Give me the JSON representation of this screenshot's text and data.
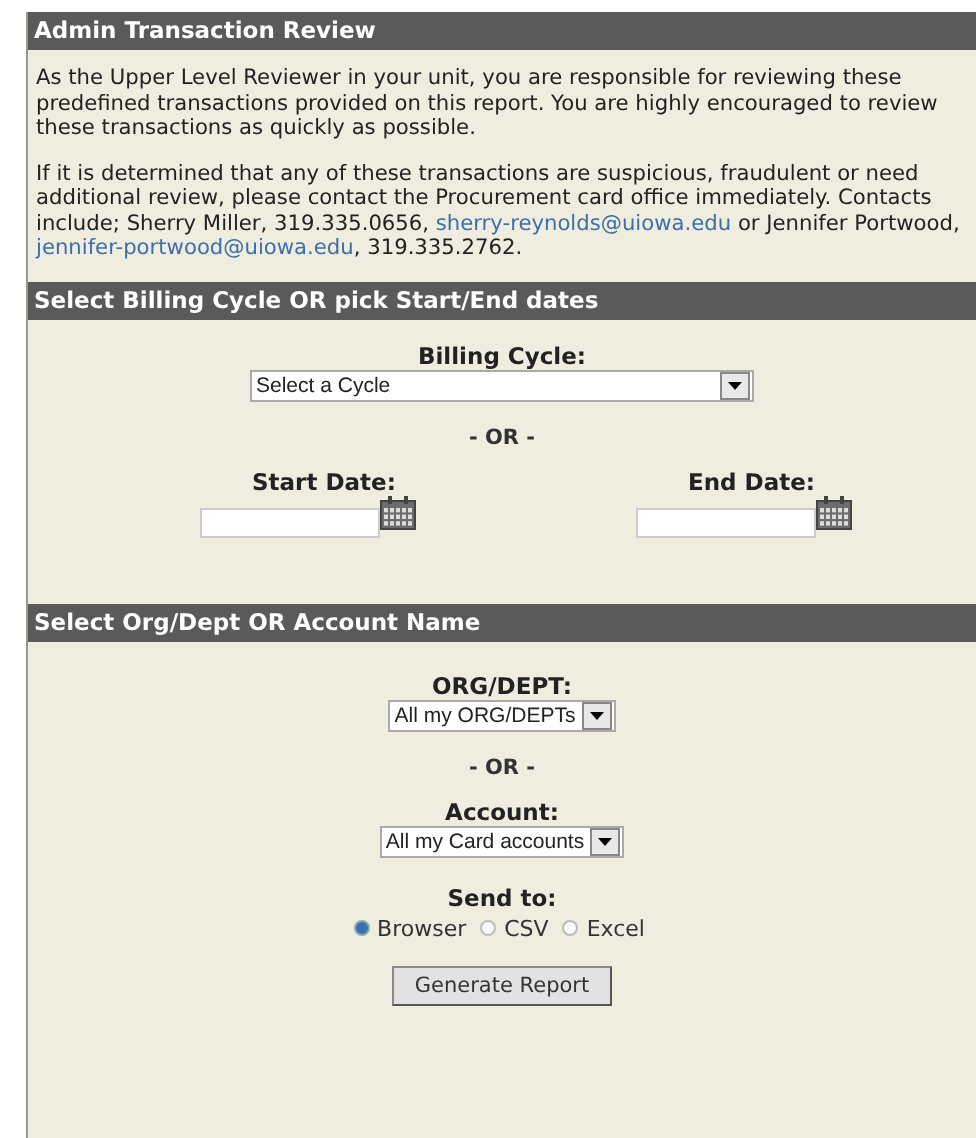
{
  "panel_title": "Admin Transaction Review",
  "paragraphs": [
    [
      {
        "kind": "text",
        "text": "As the Upper Level Reviewer in your unit, you are responsible for reviewing these predefined transactions provided on this report. You are highly encouraged to review these transactions as quickly as possible."
      }
    ],
    [
      {
        "kind": "text",
        "text": "If it is determined that any of these transactions are suspicious, fraudulent or need additional review, please contact the Procurement card office immediately. Contacts include; Sherry Miller, 319.335.0656, "
      },
      {
        "kind": "link",
        "text": "sherry-reynolds@uiowa.edu"
      },
      {
        "kind": "text",
        "text": " or Jennifer Portwood, "
      },
      {
        "kind": "link",
        "text": "jennifer-portwood@uiowa.edu"
      },
      {
        "kind": "text",
        "text": ", 319.335.2762."
      }
    ]
  ],
  "dates_section": {
    "title": "Select Billing Cycle OR pick Start/End dates",
    "billing_label": "Billing Cycle:",
    "billing_value": "Select a Cycle",
    "or": "- OR -",
    "start_label": "Start Date:",
    "end_label": "End Date:"
  },
  "org_section": {
    "title": "Select Org/Dept OR Account Name",
    "org_label": "ORG/DEPT:",
    "org_value": "All my ORG/DEPTs",
    "or": "- OR -",
    "account_label": "Account:",
    "account_value": "All my Card accounts",
    "send_label": "Send to:",
    "send_options": [
      {
        "label": "Browser",
        "selected": true
      },
      {
        "label": "CSV",
        "selected": false
      },
      {
        "label": "Excel",
        "selected": false
      }
    ],
    "button": "Generate Report"
  }
}
